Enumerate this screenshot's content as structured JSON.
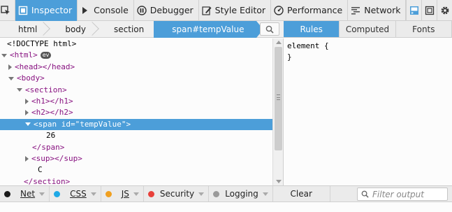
{
  "toolbar": {
    "tools": [
      {
        "label": "Inspector",
        "active": true
      },
      {
        "label": "Console"
      },
      {
        "label": "Debugger"
      },
      {
        "label": "Style Editor"
      },
      {
        "label": "Performance"
      },
      {
        "label": "Network"
      }
    ]
  },
  "breadcrumbs": [
    "html",
    "body",
    "section",
    "span#tempValue"
  ],
  "tree": [
    {
      "text": "<!DOCTYPE html>"
    },
    {
      "tag_open": "<html>",
      "badge": "ev"
    },
    {
      "tag_open": "<head></head>"
    },
    {
      "tag_open": "<body>"
    },
    {
      "tag_open": "<section>"
    },
    {
      "tag_open": "<h1></h1>"
    },
    {
      "tag_open": "<h2></h2>"
    },
    {
      "tag_start": "<span",
      "attr_name": "id",
      "attr_val": "\"tempValue\"",
      "tag_end": ">"
    },
    {
      "text": "26"
    },
    {
      "tag_open": "</span>"
    },
    {
      "tag_open": "<sup></sup>"
    },
    {
      "text": "C"
    },
    {
      "tag_open": "</section>"
    }
  ],
  "side": {
    "tabs": [
      {
        "label": "Rules",
        "active": true
      },
      {
        "label": "Computed"
      },
      {
        "label": "Fonts"
      }
    ],
    "rule_selector": "element {",
    "rule_close": "}"
  },
  "console": {
    "filters": [
      {
        "label": "Net",
        "color": "#1a1a1a"
      },
      {
        "label": "CSS",
        "color": "#1fa9e6"
      },
      {
        "label": "JS",
        "color": "#f0a020"
      },
      {
        "label": "Security",
        "color": "#e8403a"
      },
      {
        "label": "Logging",
        "color": "#9a9a9a"
      }
    ],
    "clear_label": "Clear",
    "filter_placeholder": "Filter output"
  },
  "colors": {
    "accent": "#4c9ed9"
  }
}
